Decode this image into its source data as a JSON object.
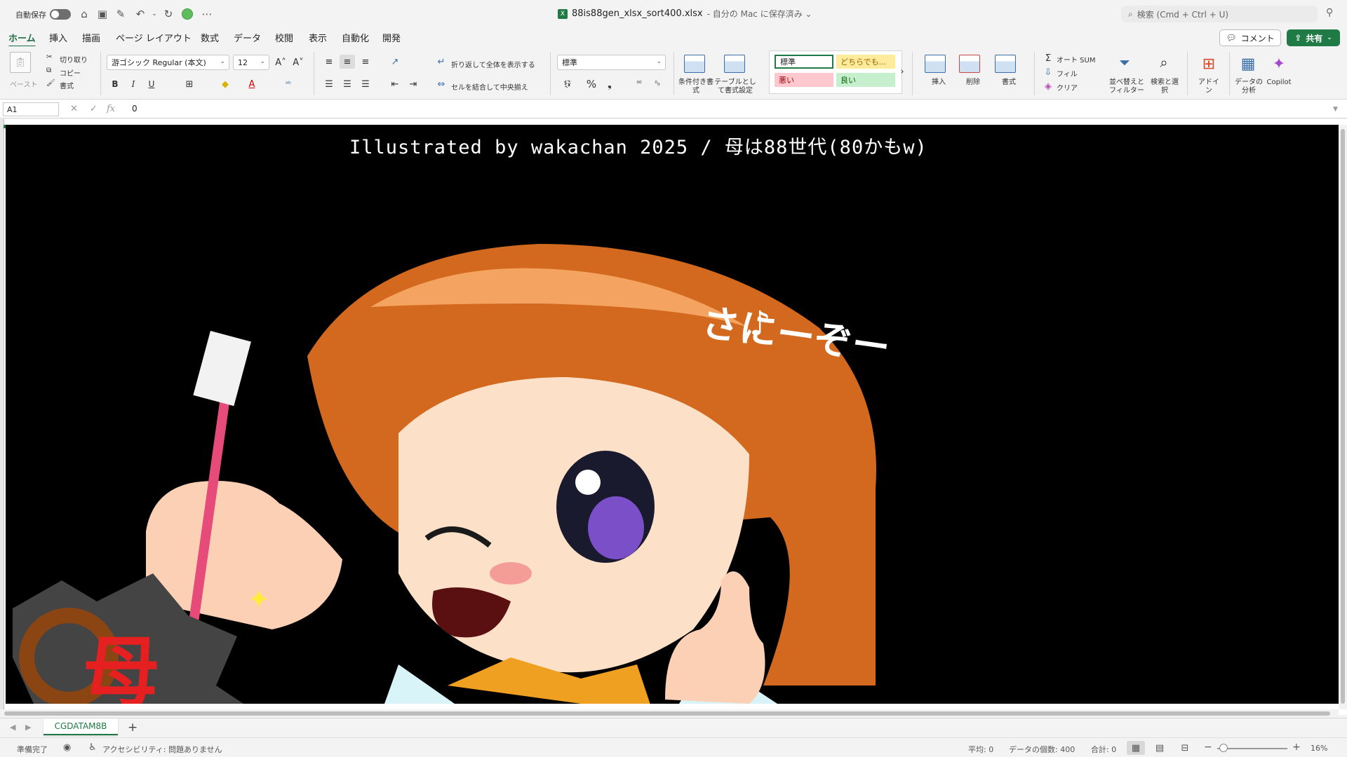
{
  "titlebar": {
    "autosave_label": "自動保存",
    "file_name": "88is88gen_xlsx_sort400.xlsx",
    "save_status": "- 自分の Mac に保存済み ⌄",
    "search_placeholder": "検索 (Cmd + Ctrl + U)"
  },
  "tabs": [
    "ホーム",
    "挿入",
    "描画",
    "ページ レイアウト",
    "数式",
    "データ",
    "校閲",
    "表示",
    "自動化",
    "開発"
  ],
  "comment_label": "コメント",
  "share_label": "共有",
  "ribbon": {
    "paste": "ペースト",
    "cut": "切り取り",
    "copy": "コピー",
    "format_painter": "書式",
    "font_name": "游ゴシック Regular (本文)",
    "font_size": "12",
    "wrap_text": "折り返して全体を表示する",
    "merge_center": "セルを結合して中央揃え",
    "number_format": "標準",
    "conditional_format": "条件付き書式",
    "format_as_table": "テーブルとして書式設定",
    "styles": {
      "normal": "標準",
      "neutral": "どちらでも...",
      "bad": "悪い",
      "good": "良い"
    },
    "insert": "挿入",
    "delete": "削除",
    "format": "書式",
    "autosum": "オート SUM",
    "fill": "フィル",
    "clear": "クリア",
    "sort_filter": "並べ替えとフィルター",
    "find_select": "検索と選択",
    "addins": "アドイン",
    "analyze_data": "データの分析",
    "copilot": "Copilot"
  },
  "formula_bar": {
    "cell_ref": "A1",
    "value": "0"
  },
  "artwork": {
    "caption": "Illustrated by wakachan 2025 / 母は88世代(80かもw)"
  },
  "sheet_tab": "CGDATAM8B",
  "statusbar": {
    "ready": "準備完了",
    "accessibility": "アクセシビリティ: 問題ありません",
    "average": "平均: 0",
    "count": "データの個数: 400",
    "sum": "合計: 0",
    "zoom": "16%"
  },
  "colors": {
    "accent_green": "#1f7a45",
    "style_normal_bg": "#ffffff",
    "style_neutral_bg": "#ffeb9c",
    "style_bad_bg": "#ffc7ce",
    "style_good_bg": "#c6efce"
  },
  "icons": [
    "home-icon",
    "save-icon",
    "undo-icon",
    "redo-icon",
    "more-icon",
    "search-icon",
    "comment-icon",
    "share-icon",
    "bold-icon",
    "italic-icon",
    "underline-icon"
  ]
}
